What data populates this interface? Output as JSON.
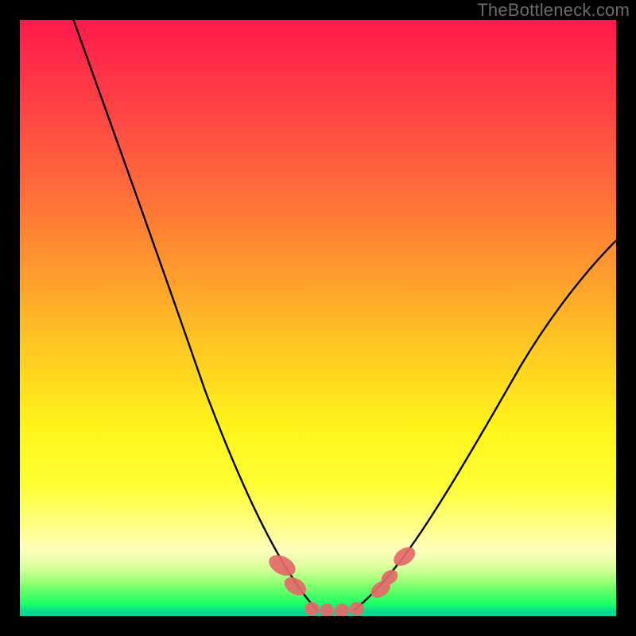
{
  "watermark": "TheBottleneck.com",
  "chart_data": {
    "type": "line",
    "title": "",
    "xlabel": "",
    "ylabel": "",
    "xlim": [
      0,
      100
    ],
    "ylim": [
      0,
      100
    ],
    "grid": false,
    "series": [
      {
        "name": "left-curve",
        "x": [
          9,
          12,
          16,
          21,
          26,
          31,
          36,
          40,
          43,
          45,
          47,
          49,
          50
        ],
        "y": [
          100,
          90,
          78,
          64,
          51,
          38,
          27,
          17,
          11,
          7,
          4,
          2,
          1
        ],
        "color": "#000000"
      },
      {
        "name": "right-curve",
        "x": [
          56,
          58,
          60,
          62,
          64,
          67,
          71,
          76,
          82,
          88,
          94,
          100
        ],
        "y": [
          1,
          2,
          4,
          6,
          9,
          14,
          21,
          30,
          40,
          49,
          57,
          63
        ],
        "color": "#000000"
      }
    ],
    "markers": [
      {
        "name": "left-cluster-1",
        "cx": 44.0,
        "cy": 8.5,
        "rx": 1.5,
        "ry": 2.4,
        "rot": -62
      },
      {
        "name": "left-cluster-2",
        "cx": 46.2,
        "cy": 5.0,
        "rx": 1.3,
        "ry": 2.0,
        "rot": -58
      },
      {
        "name": "valley-1",
        "cx": 49.0,
        "cy": 1.2,
        "rx": 1.2,
        "ry": 1.2,
        "rot": 0
      },
      {
        "name": "valley-2",
        "cx": 51.5,
        "cy": 0.9,
        "rx": 1.2,
        "ry": 1.2,
        "rot": 0
      },
      {
        "name": "valley-3",
        "cx": 54.0,
        "cy": 0.9,
        "rx": 1.2,
        "ry": 1.2,
        "rot": 0
      },
      {
        "name": "valley-4",
        "cx": 56.5,
        "cy": 1.2,
        "rx": 1.2,
        "ry": 1.2,
        "rot": 0
      },
      {
        "name": "right-cluster-1",
        "cx": 60.5,
        "cy": 4.5,
        "rx": 1.2,
        "ry": 1.8,
        "rot": 55
      },
      {
        "name": "right-cluster-2",
        "cx": 62.0,
        "cy": 6.5,
        "rx": 1.1,
        "ry": 1.5,
        "rot": 55
      },
      {
        "name": "right-cluster-3",
        "cx": 64.5,
        "cy": 10.0,
        "rx": 1.3,
        "ry": 2.0,
        "rot": 55
      }
    ],
    "marker_color": "#e46a6a",
    "gradient_stops": [
      {
        "pos": 0,
        "color": "#ff1a4d"
      },
      {
        "pos": 28,
        "color": "#ff6a3a"
      },
      {
        "pos": 55,
        "color": "#ffc822"
      },
      {
        "pos": 78,
        "color": "#ffff33"
      },
      {
        "pos": 92,
        "color": "#d8ff99"
      },
      {
        "pos": 100,
        "color": "#0ad29e"
      }
    ]
  }
}
